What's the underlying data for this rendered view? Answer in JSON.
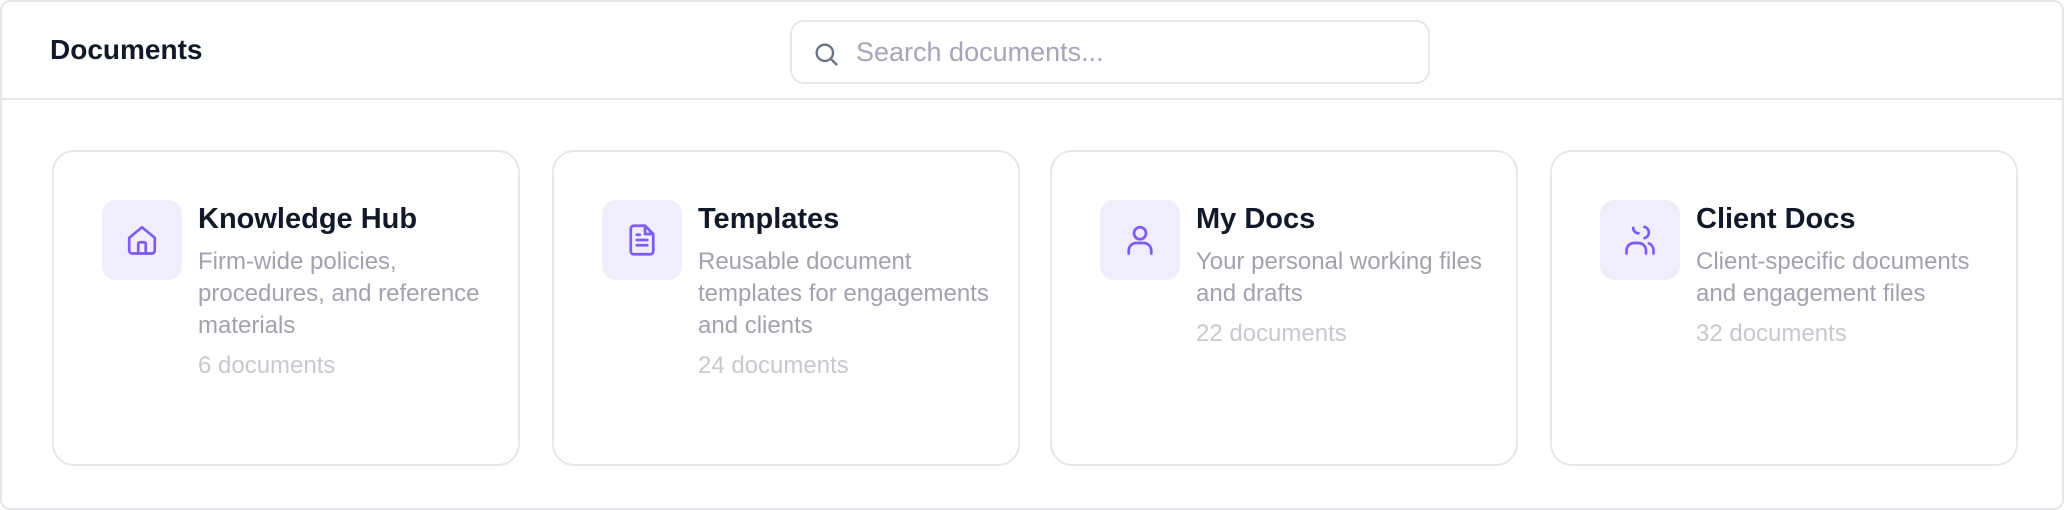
{
  "header": {
    "title": "Documents",
    "search": {
      "placeholder": "Search documents...",
      "value": "",
      "icon": "search-icon"
    }
  },
  "colors": {
    "accent": "#7c5cf5",
    "icon_tile_bg": "#f0edfd",
    "border": "#e5e7eb",
    "muted_text": "#a3a1ad",
    "count_text": "#c9c8cf"
  },
  "collections": [
    {
      "title": "Knowledge Hub",
      "description": "Firm-wide policies, procedures, and reference materials",
      "count": "6 documents",
      "icon": "home-icon"
    },
    {
      "title": "Templates",
      "description": "Reusable document templates for engagements and clients",
      "count": "24 documents",
      "icon": "document-icon"
    },
    {
      "title": "My Docs",
      "description": "Your personal working files and drafts",
      "count": "22 documents",
      "icon": "user-icon"
    },
    {
      "title": "Client Docs",
      "description": "Client-specific documents and engagement files",
      "count": "32 documents",
      "icon": "users-icon"
    }
  ]
}
